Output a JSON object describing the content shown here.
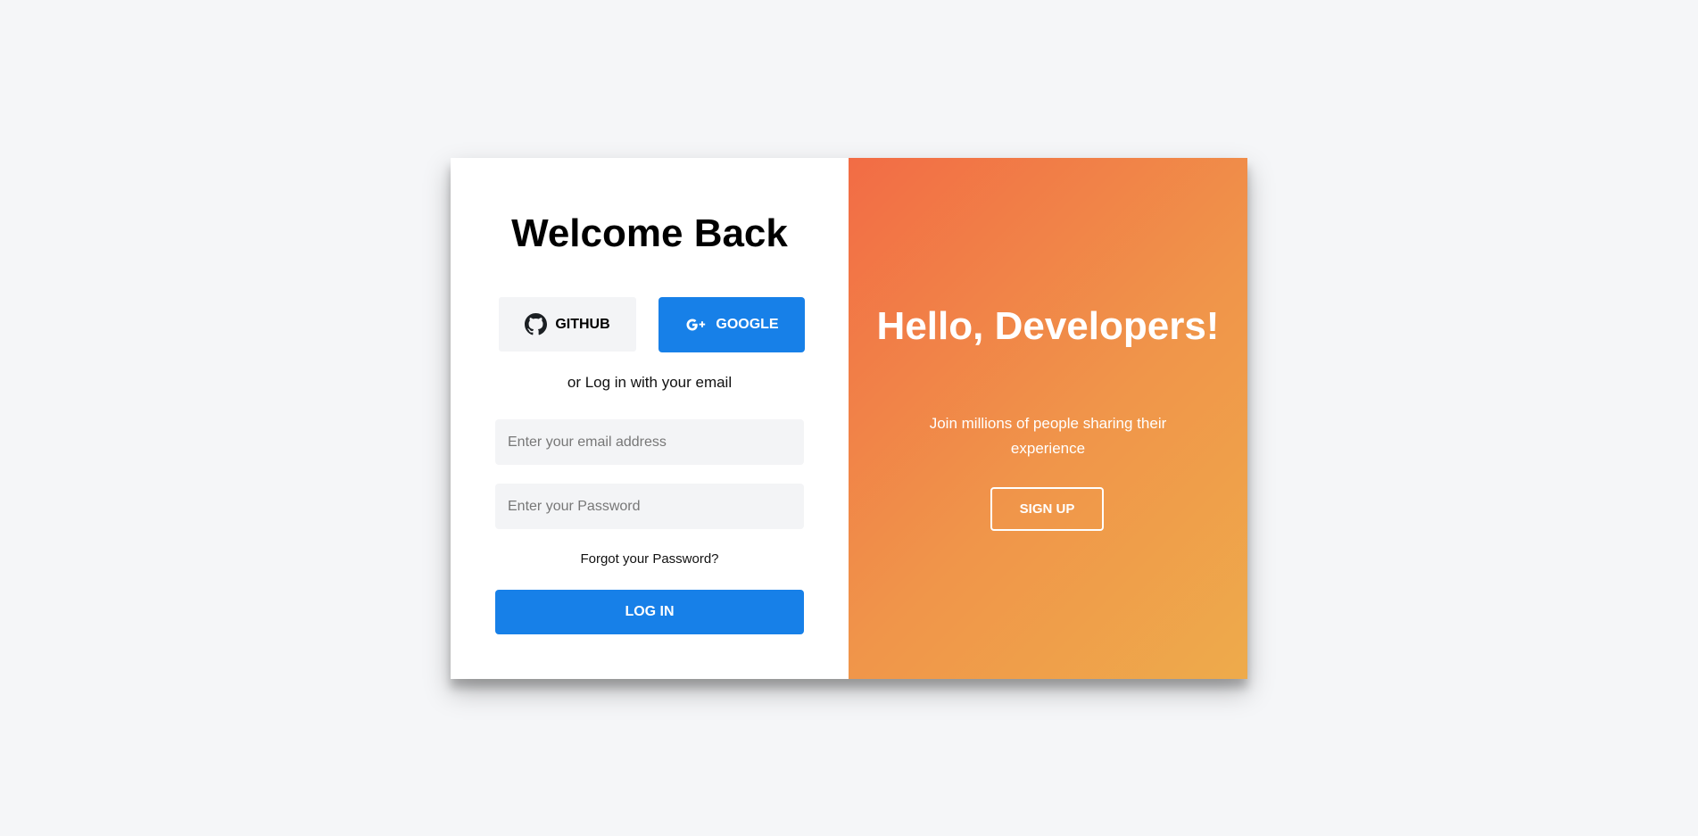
{
  "login_panel": {
    "title": "Welcome Back",
    "github_label": "GITHUB",
    "github_icon": "github-icon",
    "google_label": "GOOGLE",
    "google_icon": "google-plus-icon",
    "divider_text": "or Log in with your email",
    "email_placeholder": "Enter your email address",
    "password_placeholder": "Enter your Password",
    "forgot_link": "Forgot your Password?",
    "login_button": "LOG IN"
  },
  "signup_panel": {
    "heading": "Hello, Developers!",
    "subtext": "Join millions of people sharing their experience",
    "signup_button": "SIGN UP"
  },
  "colors": {
    "accent_blue": "#1780e8",
    "gradient_start": "#f26c45",
    "gradient_end": "#eeab4b",
    "page_background": "#f5f6f8"
  }
}
